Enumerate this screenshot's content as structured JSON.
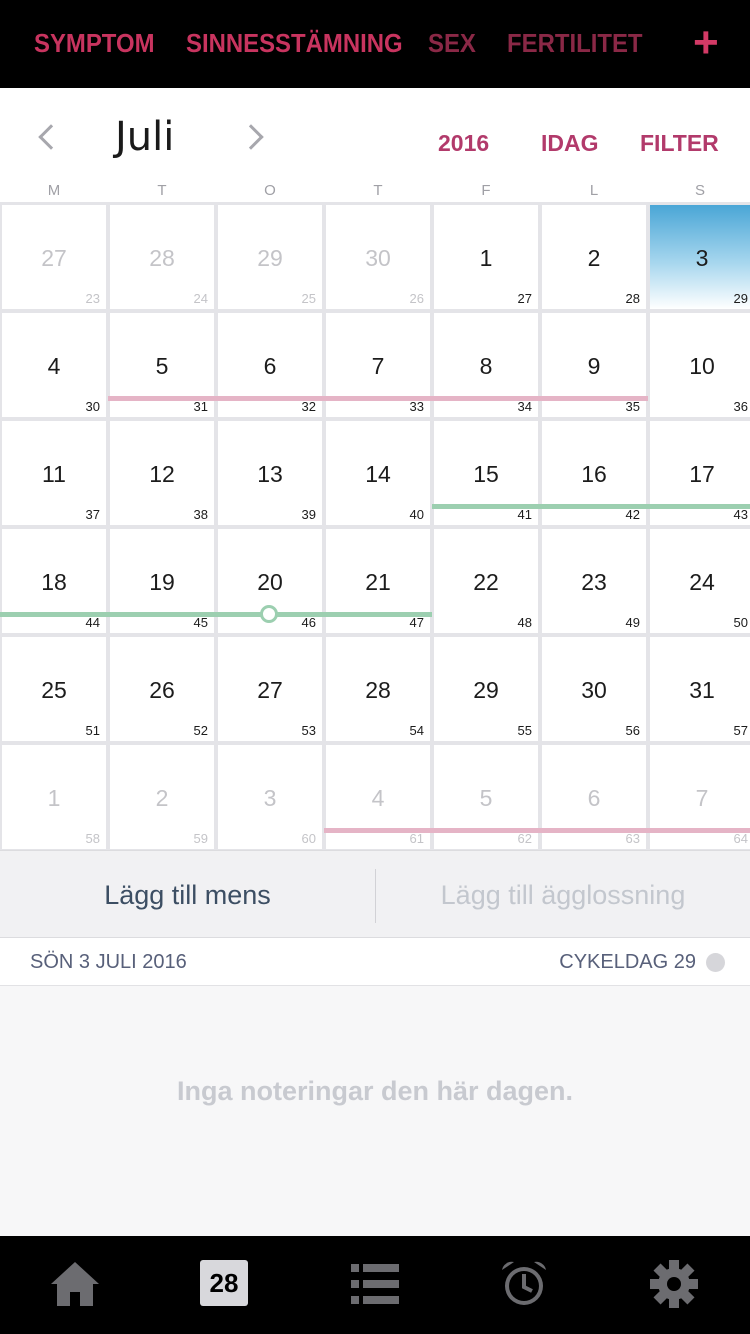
{
  "top_tabs": [
    {
      "label": "SYMPTOM"
    },
    {
      "label": "SINNESSTÄMNING"
    },
    {
      "label": "SEX"
    },
    {
      "label": "FERTILITET"
    }
  ],
  "add_icon": "plus-icon",
  "header": {
    "month": "Juli",
    "year_button": "2016",
    "today_button": "IDAG",
    "filter_button": "FILTER"
  },
  "weekdays": [
    "M",
    "T",
    "O",
    "T",
    "F",
    "L",
    "S"
  ],
  "calendar": {
    "selected_day": "3",
    "weeks": [
      [
        {
          "d": "27",
          "c": "23",
          "o": true
        },
        {
          "d": "28",
          "c": "24",
          "o": true
        },
        {
          "d": "29",
          "c": "25",
          "o": true
        },
        {
          "d": "30",
          "c": "26",
          "o": true
        },
        {
          "d": "1",
          "c": "27"
        },
        {
          "d": "2",
          "c": "28"
        },
        {
          "d": "3",
          "c": "29",
          "sel": true
        }
      ],
      [
        {
          "d": "4",
          "c": "30"
        },
        {
          "d": "5",
          "c": "31"
        },
        {
          "d": "6",
          "c": "32"
        },
        {
          "d": "7",
          "c": "33"
        },
        {
          "d": "8",
          "c": "34"
        },
        {
          "d": "9",
          "c": "35"
        },
        {
          "d": "10",
          "c": "36"
        }
      ],
      [
        {
          "d": "11",
          "c": "37"
        },
        {
          "d": "12",
          "c": "38"
        },
        {
          "d": "13",
          "c": "39"
        },
        {
          "d": "14",
          "c": "40"
        },
        {
          "d": "15",
          "c": "41"
        },
        {
          "d": "16",
          "c": "42"
        },
        {
          "d": "17",
          "c": "43"
        }
      ],
      [
        {
          "d": "18",
          "c": "44"
        },
        {
          "d": "19",
          "c": "45"
        },
        {
          "d": "20",
          "c": "46"
        },
        {
          "d": "21",
          "c": "47"
        },
        {
          "d": "22",
          "c": "48"
        },
        {
          "d": "23",
          "c": "49"
        },
        {
          "d": "24",
          "c": "50"
        }
      ],
      [
        {
          "d": "25",
          "c": "51"
        },
        {
          "d": "26",
          "c": "52"
        },
        {
          "d": "27",
          "c": "53"
        },
        {
          "d": "28",
          "c": "54"
        },
        {
          "d": "29",
          "c": "55"
        },
        {
          "d": "30",
          "c": "56"
        },
        {
          "d": "31",
          "c": "57"
        }
      ],
      [
        {
          "d": "1",
          "c": "58",
          "o": true
        },
        {
          "d": "2",
          "c": "59",
          "o": true
        },
        {
          "d": "3",
          "c": "60",
          "o": true
        },
        {
          "d": "4",
          "c": "61",
          "o": true
        },
        {
          "d": "5",
          "c": "62",
          "o": true
        },
        {
          "d": "6",
          "c": "63",
          "o": true
        },
        {
          "d": "7",
          "c": "64",
          "o": true
        }
      ]
    ]
  },
  "colors": {
    "accent": "#c8345f",
    "period_bar": "#e5b4c6",
    "fertile_bar": "#9ccfb0",
    "selected_day": "#4aa6d6"
  },
  "actions": {
    "add_period": "Lägg till mens",
    "add_ovulation": "Lägg till ägglossning"
  },
  "day_info": {
    "date": "SÖN 3 JULI 2016",
    "cycle_day": "CYKELDAG 29"
  },
  "notes": {
    "empty_text": "Inga noteringar den här dagen."
  },
  "tab_bar": {
    "calendar_day": "28",
    "icons": [
      "home-icon",
      "calendar-icon",
      "list-icon",
      "alarm-clock-icon",
      "gear-icon"
    ]
  }
}
